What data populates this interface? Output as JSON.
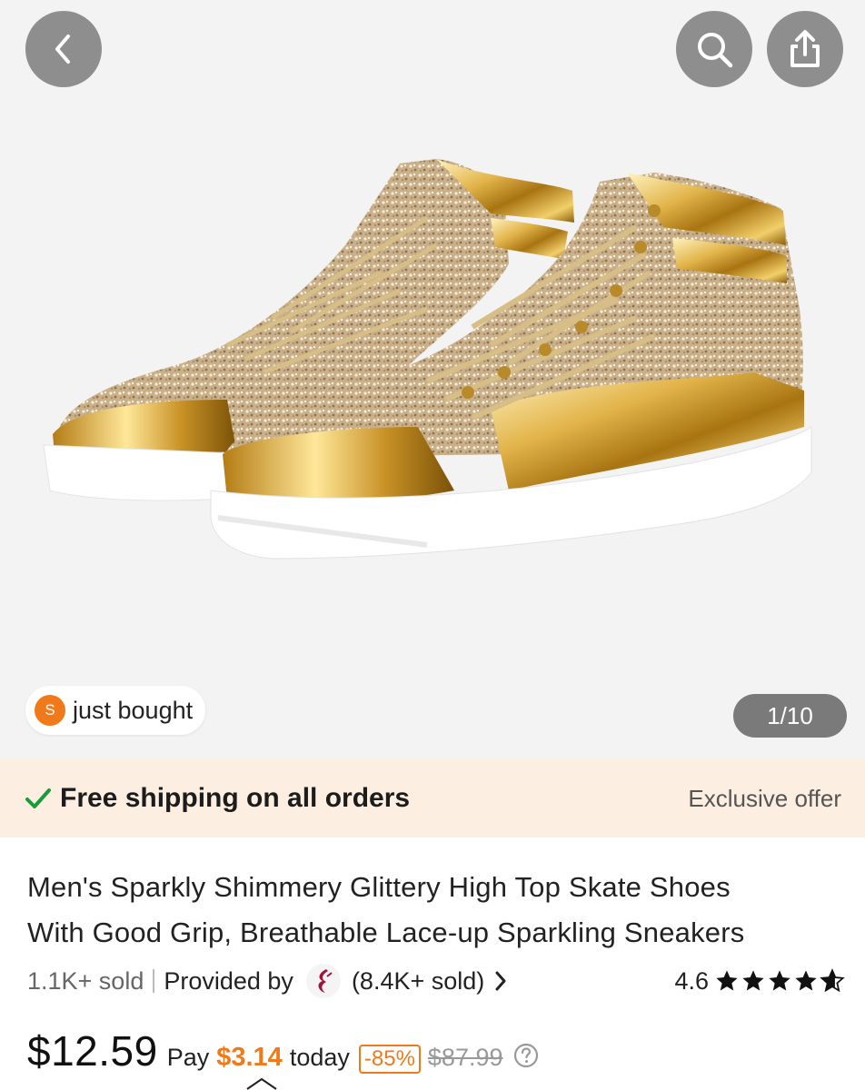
{
  "header": {
    "back_icon": "chevron-left-icon",
    "search_icon": "search-icon",
    "share_icon": "share-icon"
  },
  "gallery": {
    "just_bought_avatar": "S",
    "just_bought_label": "just bought",
    "counter": "1/10"
  },
  "shipping": {
    "label": "Free shipping on all orders",
    "offer": "Exclusive offer",
    "check_color": "#1a9a3a"
  },
  "product": {
    "title_line1": "Men's Sparkly Shimmery Glittery High Top Skate Shoes",
    "title_line2": "With Good Grip, Breathable Lace-up Sparkling Sneakers",
    "sold": "1.1K+ sold",
    "provided_by": "Provided by",
    "store_sold": "(8.4K+ sold)",
    "rating": "4.6",
    "stars_filled": 4.6
  },
  "price": {
    "current": "$12.59",
    "pay_label": "Pay",
    "pay_amount": "$3.14",
    "today": "today",
    "discount": "-85%",
    "original": "$87.99"
  },
  "colors": {
    "accent": "#f07a1a",
    "banner_bg": "#fdeee2"
  }
}
